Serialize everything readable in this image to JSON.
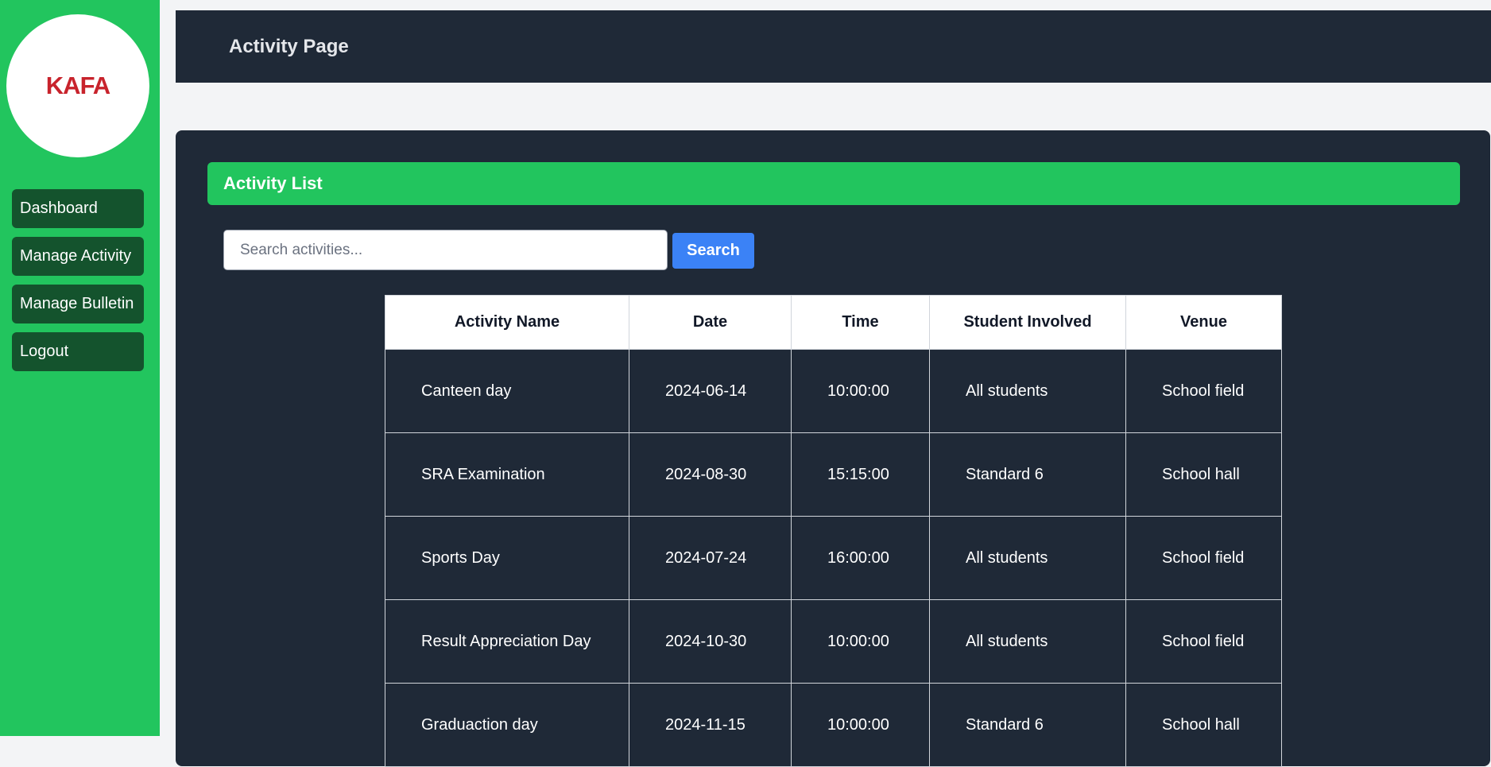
{
  "logo": {
    "text": "KAFA"
  },
  "sidebar": {
    "items": [
      {
        "label": "Dashboard"
      },
      {
        "label": "Manage Activity"
      },
      {
        "label": "Manage Bulletin"
      },
      {
        "label": "Logout"
      }
    ]
  },
  "header": {
    "title": "Activity Page"
  },
  "activity_list": {
    "title": "Activity List",
    "search": {
      "placeholder": "Search activities...",
      "value": "",
      "button_label": "Search"
    },
    "columns": [
      "Activity Name",
      "Date",
      "Time",
      "Student Involved",
      "Venue"
    ],
    "rows": [
      [
        "Canteen day",
        "2024-06-14",
        "10:00:00",
        "All students",
        "School field"
      ],
      [
        "SRA Examination",
        "2024-08-30",
        "15:15:00",
        "Standard 6",
        "School hall"
      ],
      [
        "Sports Day",
        "2024-07-24",
        "16:00:00",
        "All students",
        "School field"
      ],
      [
        "Result Appreciation Day",
        "2024-10-30",
        "10:00:00",
        "All students",
        "School field"
      ],
      [
        "Graduaction day",
        "2024-11-15",
        "10:00:00",
        "Standard 6",
        "School hall"
      ]
    ]
  },
  "colors": {
    "sidebar_green": "#22c55e",
    "nav_dark_green": "#14532d",
    "panel_dark": "#1f2937",
    "search_blue": "#3b82f6",
    "logo_red": "#c8232c"
  }
}
